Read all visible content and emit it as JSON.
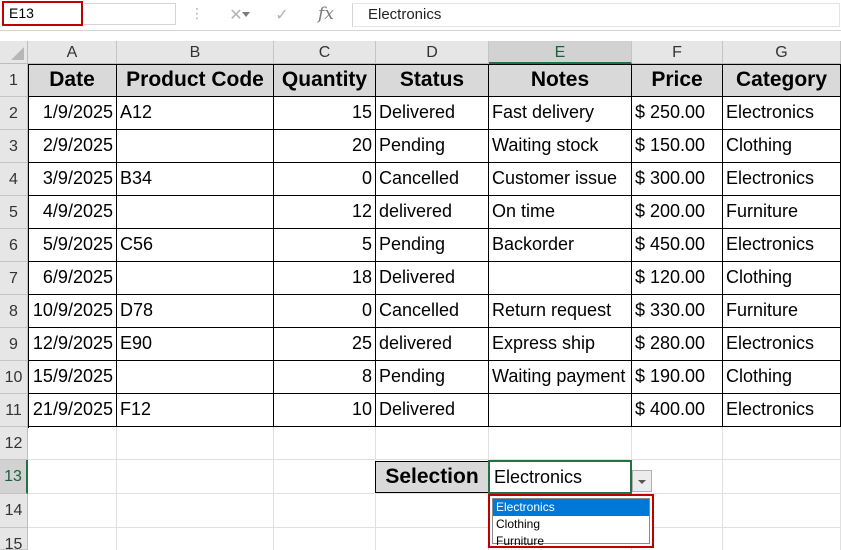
{
  "formula_bar": {
    "name_box": "E13",
    "cancel_icon": "close-icon",
    "enter_icon": "checkmark-icon",
    "fx_label": "fx",
    "formula_value": "Electronics"
  },
  "columns": [
    "A",
    "B",
    "C",
    "D",
    "E",
    "F",
    "G"
  ],
  "rows": [
    "1",
    "2",
    "3",
    "4",
    "5",
    "6",
    "7",
    "8",
    "9",
    "10",
    "11",
    "12",
    "13",
    "14",
    "15"
  ],
  "table": {
    "headers": [
      "Date",
      "Product Code",
      "Quantity",
      "Status",
      "Notes",
      "Price",
      "Category"
    ],
    "data": [
      [
        "1/9/2025",
        "A12",
        "15",
        "Delivered",
        "Fast delivery",
        "$ 250.00",
        "Electronics"
      ],
      [
        "2/9/2025",
        "",
        "20",
        "Pending",
        "Waiting stock",
        "$ 150.00",
        "Clothing"
      ],
      [
        "3/9/2025",
        "B34",
        "0",
        "Cancelled",
        "Customer issue",
        "$ 300.00",
        "Electronics"
      ],
      [
        "4/9/2025",
        "",
        "12",
        "delivered",
        "On time",
        "$ 200.00",
        "Furniture"
      ],
      [
        "5/9/2025",
        "C56",
        "5",
        "Pending",
        "Backorder",
        "$ 450.00",
        "Electronics"
      ],
      [
        "6/9/2025",
        "",
        "18",
        "Delivered",
        "",
        "$ 120.00",
        "Clothing"
      ],
      [
        "10/9/2025",
        "D78",
        "0",
        "Cancelled",
        "Return request",
        "$ 330.00",
        "Furniture"
      ],
      [
        "12/9/2025",
        "E90",
        "25",
        "delivered",
        "Express ship",
        "$ 280.00",
        "Electronics"
      ],
      [
        "15/9/2025",
        "",
        "8",
        "Pending",
        "Waiting payment",
        "$ 190.00",
        "Clothing"
      ],
      [
        "21/9/2025",
        "F12",
        "10",
        "Delivered",
        "",
        "$ 400.00",
        "Electronics"
      ]
    ]
  },
  "selection": {
    "label": "Selection",
    "value": "Electronics",
    "options": [
      "Electronics",
      "Clothing",
      "Furniture"
    ],
    "highlighted_option": "Electronics"
  },
  "selected_cell": "E13",
  "colors": {
    "header_fill": "#d9d9d9",
    "selection_green": "#217346",
    "highlight_red": "#c00000",
    "dropdown_active": "#0078d7"
  }
}
